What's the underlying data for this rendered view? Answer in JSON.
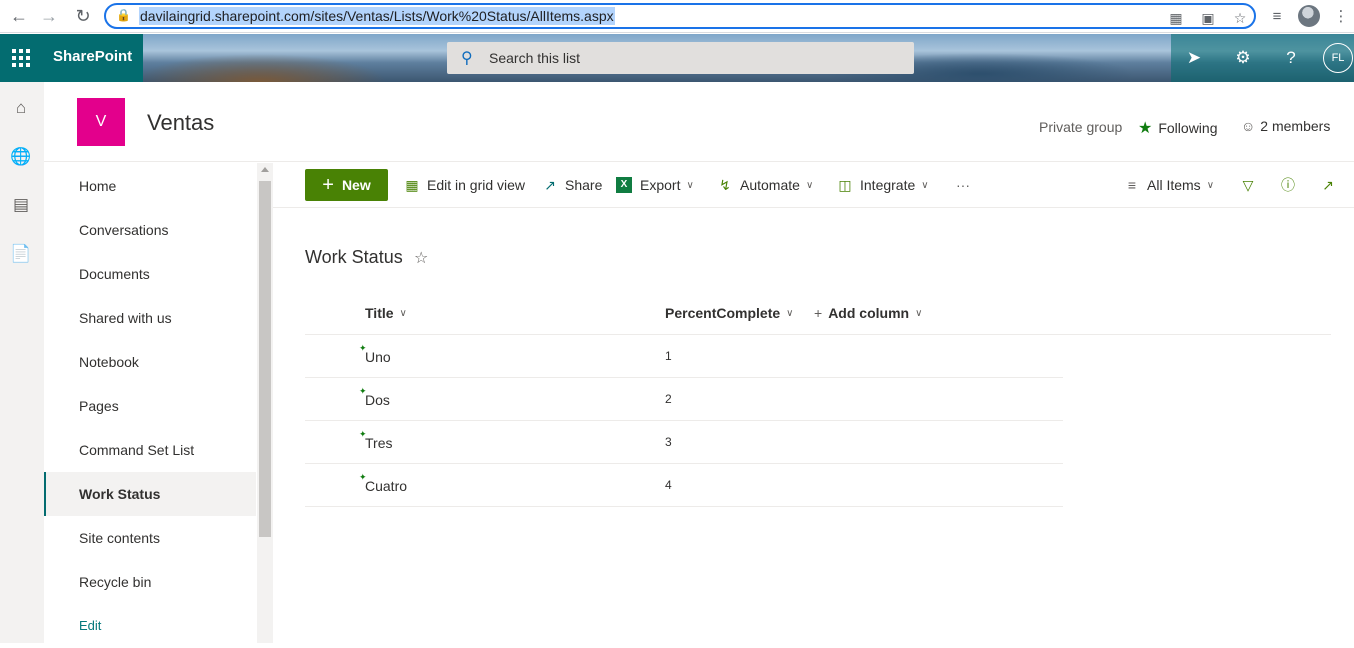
{
  "browser": {
    "url": "davilaingrid.sharepoint.com/sites/Ventas/Lists/Work%20Status/AllItems.aspx",
    "back_icon": "arrow-left",
    "forward_icon": "arrow-right",
    "reload_icon": "reload"
  },
  "suite_bar": {
    "brand": "SharePoint",
    "search_placeholder": "Search this list",
    "accent": "#036c70"
  },
  "user": {
    "initials": "FL"
  },
  "site": {
    "logo_letter": "V",
    "logo_color": "#e3008c",
    "title": "Ventas",
    "privacy": "Private group",
    "following_label": "Following",
    "members_label": "2 members"
  },
  "left_nav": {
    "items": [
      {
        "label": "Home"
      },
      {
        "label": "Conversations"
      },
      {
        "label": "Documents"
      },
      {
        "label": "Shared with us"
      },
      {
        "label": "Notebook"
      },
      {
        "label": "Pages"
      },
      {
        "label": "Command Set List"
      },
      {
        "label": "Work Status",
        "selected": true
      },
      {
        "label": "Site contents"
      },
      {
        "label": "Recycle bin"
      }
    ],
    "edit_label": "Edit"
  },
  "command_bar": {
    "new_label": "New",
    "new_color": "#498205",
    "edit_grid_label": "Edit in grid view",
    "share_label": "Share",
    "export_label": "Export",
    "automate_label": "Automate",
    "integrate_label": "Integrate",
    "more_label": "···",
    "view_label": "All Items"
  },
  "list": {
    "title": "Work Status",
    "columns": {
      "title": "Title",
      "percent": "PercentComplete",
      "add": "Add column"
    },
    "rows": [
      {
        "title": "Uno",
        "percent": "1"
      },
      {
        "title": "Dos",
        "percent": "2"
      },
      {
        "title": "Tres",
        "percent": "3"
      },
      {
        "title": "Cuatro",
        "percent": "4"
      }
    ]
  }
}
